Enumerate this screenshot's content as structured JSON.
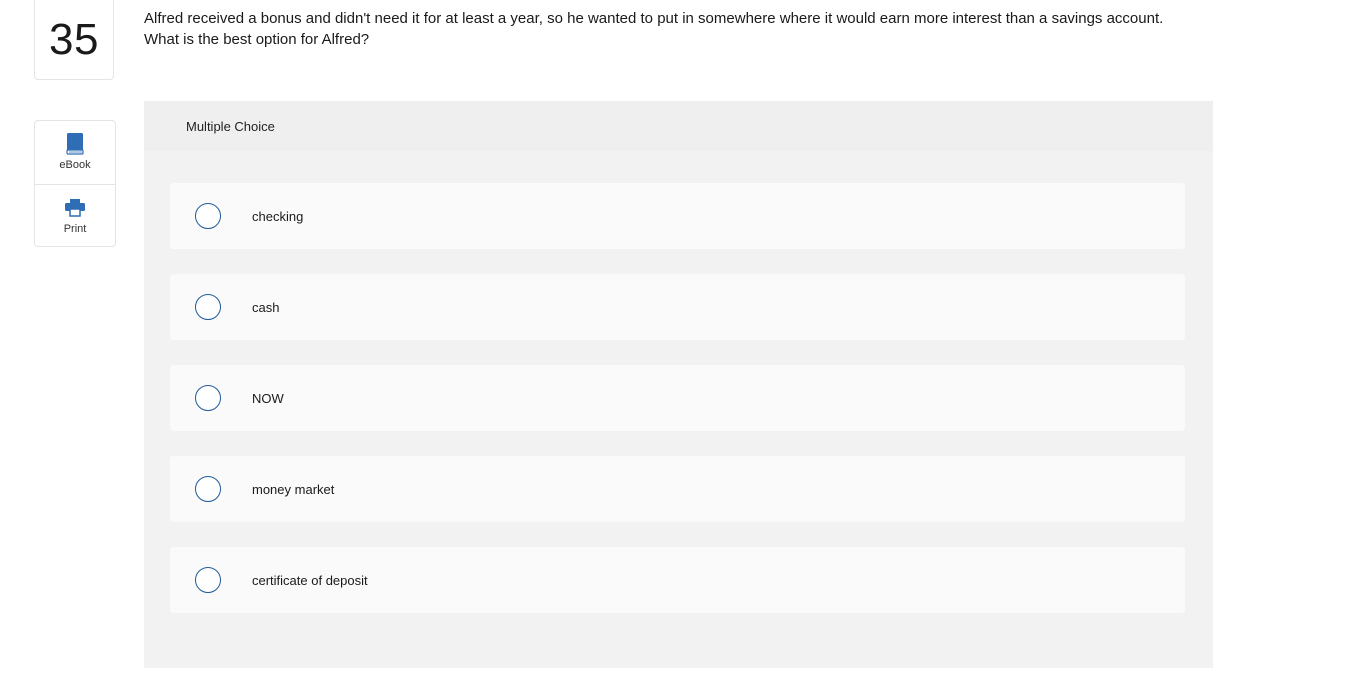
{
  "question": {
    "number": "35",
    "text": "Alfred received a bonus and didn't need it for at least a year, so he wanted to put in somewhere where it would earn more interest than a savings account. What is the best option for Alfred?"
  },
  "tools": [
    {
      "label": "eBook",
      "icon": "book-icon"
    },
    {
      "label": "Print",
      "icon": "printer-icon"
    }
  ],
  "multiple_choice": {
    "header": "Multiple Choice",
    "options": [
      {
        "label": "checking"
      },
      {
        "label": "cash"
      },
      {
        "label": "NOW"
      },
      {
        "label": "money market"
      },
      {
        "label": "certificate of deposit"
      }
    ]
  },
  "colors": {
    "accent": "#1f5a9a",
    "panel_bg": "#f2f2f2",
    "option_bg": "#fafafa"
  }
}
